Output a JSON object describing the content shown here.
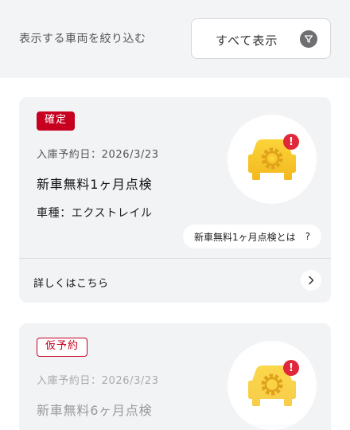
{
  "filter": {
    "label": "表示する車両を絞り込む",
    "selected": "すべて表示",
    "icon": "filter-icon"
  },
  "cards": [
    {
      "status": "確定",
      "date": "入庫予約日：2026/3/23",
      "title": "新車無料1ヶ月点検",
      "model": "車種：エクストレイル",
      "info_label": "新車無料1ヶ月点検とは",
      "info_icon": "?",
      "details_label": "詳しくはこちら",
      "alert": "!"
    },
    {
      "status": "仮予約",
      "date": "入庫予約日：2026/3/23",
      "title": "新車無料6ヶ月点検",
      "alert": "!"
    }
  ],
  "colors": {
    "accent_red": "#c7001f",
    "car_yellow": "#f7c62b",
    "background": "#f3f4f6"
  }
}
